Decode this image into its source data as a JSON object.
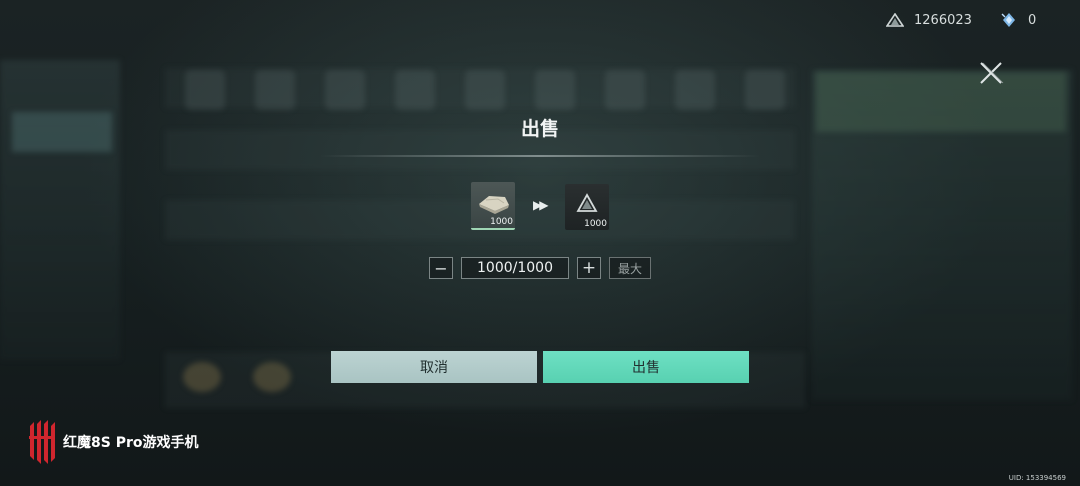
{
  "currency": [
    {
      "icon": "crystal-triangle-icon",
      "value": "1266023"
    },
    {
      "icon": "diamond-spark-icon",
      "value": "0"
    }
  ],
  "dialog": {
    "title": "出售",
    "from_item": {
      "icon": "cloth-material-icon",
      "quantity": "1000"
    },
    "to_item": {
      "icon": "crystal-triangle-icon",
      "quantity": "1000"
    },
    "arrow": "»",
    "quantity_value": "1000/1000",
    "minus_label": "−",
    "plus_label": "+",
    "max_label": "最大",
    "cancel_label": "取消",
    "confirm_label": "出售"
  },
  "watermark": {
    "brand": "红魔8S Pro游戏手机",
    "uid": "UID: 153394569"
  },
  "colors": {
    "confirm": "#5fd8b8",
    "cancel": "#b3cccb",
    "accent": "#9fd6b4"
  }
}
